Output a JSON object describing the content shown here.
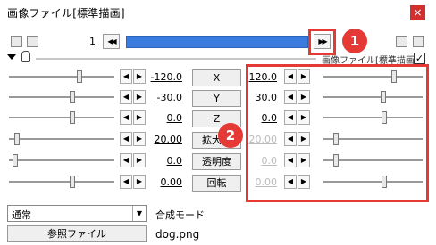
{
  "window": {
    "title": "画像ファイル[標準描画]",
    "close_glyph": "×"
  },
  "toolbar": {
    "frame_number": "1",
    "icons": [
      "film-icon",
      "image-icon"
    ],
    "prev_glyph": "◀◀",
    "next_glyph": "▶▶",
    "right_icons": [
      "refresh-icon",
      "plus-icon"
    ]
  },
  "annotations": {
    "badge1": "1",
    "badge2": "2"
  },
  "object_label": "画像ファイル[標準描画]",
  "checkbox_mark": "✓",
  "params": [
    {
      "name": "X",
      "left": "-120.0",
      "right": "120.0",
      "left_slider": 0.68,
      "right_slider": 0.72,
      "disabled": false
    },
    {
      "name": "Y",
      "left": "-30.0",
      "right": "30.0",
      "left_slider": 0.61,
      "right_slider": 0.6,
      "disabled": false
    },
    {
      "name": "Z",
      "left": "0.0",
      "right": "0.0",
      "left_slider": 0.61,
      "right_slider": 0.61,
      "disabled": false
    },
    {
      "name": "拡大率",
      "left": "20.00",
      "right": "20.00",
      "left_slider": 0.05,
      "right_slider": 0.1,
      "disabled": true
    },
    {
      "name": "透明度",
      "left": "0.0",
      "right": "0.0",
      "left_slider": 0.04,
      "right_slider": 0.1,
      "disabled": true
    },
    {
      "name": "回転",
      "left": "0.00",
      "right": "0.00",
      "left_slider": 0.61,
      "right_slider": 0.61,
      "disabled": true
    }
  ],
  "arrows": {
    "left": "◀",
    "right": "▶"
  },
  "blend": {
    "value": "通常",
    "label": "合成モード",
    "dropdown_glyph": "▼"
  },
  "file": {
    "button_label": "参照ファイル",
    "name": "dog.png"
  },
  "colors": {
    "accent_red": "#e53935",
    "seek_blue": "#3a7be0"
  }
}
